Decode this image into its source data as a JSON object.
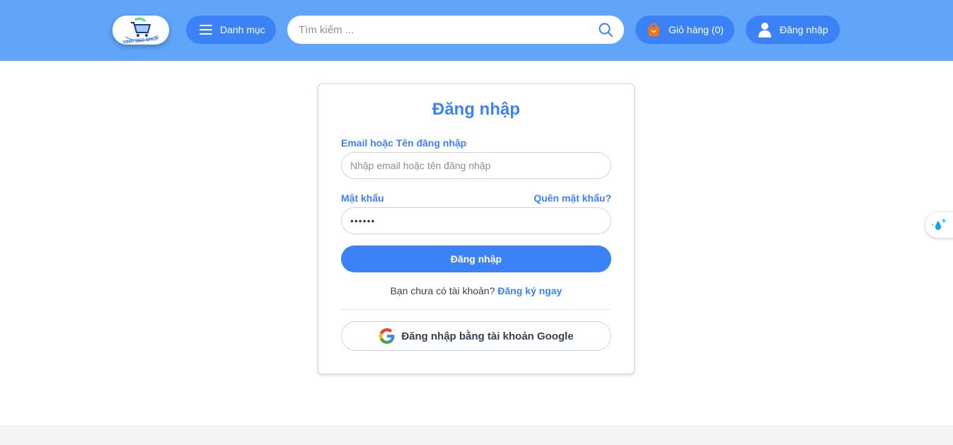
{
  "header": {
    "logo_text": "VINH SEO SHOP",
    "menu_label": "Danh mục",
    "search_placeholder": "Tìm kiếm ...",
    "cart_label": "Giỏ hàng (0)",
    "login_label": "Đăng nhập",
    "colors": {
      "bar": "#60a5fa",
      "button": "#3b82f6",
      "cart_icon": "#f97316"
    },
    "icons": [
      "menu-icon",
      "search-icon",
      "shopping-bag-icon",
      "user-icon"
    ]
  },
  "login_form": {
    "title": "Đăng nhập",
    "email_label": "Email hoặc Tên đăng nhập",
    "email_placeholder": "Nhập email hoặc tên đăng nhập",
    "password_label": "Mật khẩu",
    "password_value": "••••••",
    "forgot_link": "Quên mật khẩu?",
    "submit_label": "Đăng nhập",
    "register_prompt": "Bạn chưa có tài khoản?",
    "register_link": "Đăng ký ngay",
    "google_label": "Đăng nhập bằng tài khoản Google"
  },
  "side_widget": {
    "icon": "water-drop-sparkle-icon"
  }
}
